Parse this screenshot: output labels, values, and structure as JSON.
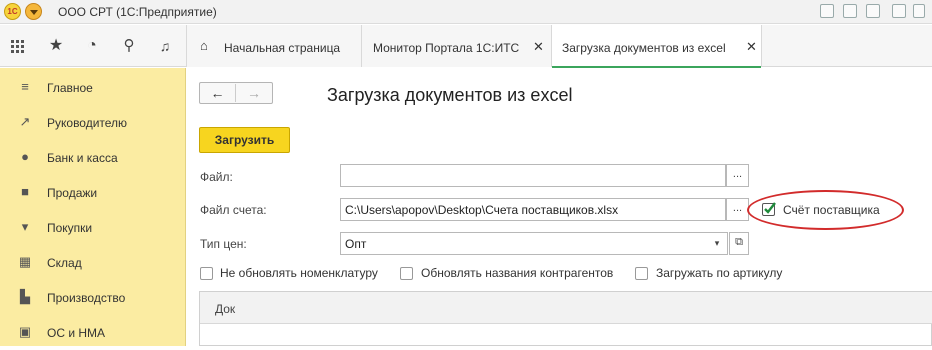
{
  "window": {
    "title": "ООО СРТ  (1С:Предприятие)",
    "logo_text": "1С"
  },
  "tabs": [
    {
      "label": "Начальная страница"
    },
    {
      "label": "Монитор Портала 1С:ИТС"
    },
    {
      "label": "Загрузка документов из excel"
    }
  ],
  "sidebar": {
    "items": [
      {
        "label": "Главное",
        "icon": "menu-lines-icon"
      },
      {
        "label": "Руководителю",
        "icon": "trend-icon"
      },
      {
        "label": "Банк и касса",
        "icon": "coin-icon"
      },
      {
        "label": "Продажи",
        "icon": "bag-icon"
      },
      {
        "label": "Покупки",
        "icon": "cart-icon"
      },
      {
        "label": "Склад",
        "icon": "grid-icon"
      },
      {
        "label": "Производство",
        "icon": "factory-icon"
      },
      {
        "label": "ОС и НМА",
        "icon": "box-icon"
      }
    ]
  },
  "form": {
    "title": "Загрузка документов из excel",
    "load_button": "Загрузить",
    "file_label": "Файл:",
    "file_value": "",
    "account_file_label": "Файл счета:",
    "account_file_value": "C:\\Users\\apopov\\Desktop\\Счета поставщиков.xlsx",
    "supplier_invoice_label": "Счёт поставщика",
    "supplier_invoice_checked": true,
    "price_type_label": "Тип цен:",
    "price_type_value": "Опт",
    "dots": "...",
    "checkboxes": [
      {
        "label": "Не обновлять номенклатуру",
        "checked": false
      },
      {
        "label": "Обновлять названия контрагентов",
        "checked": false
      },
      {
        "label": "Загружать по артикулу",
        "checked": false
      }
    ],
    "table_header": "Док"
  },
  "colors": {
    "accent_yellow": "#f7d51f",
    "sidebar_bg": "#fbeca2",
    "active_tab_underline": "#3ba55c",
    "highlight_red": "#d22b2b"
  }
}
